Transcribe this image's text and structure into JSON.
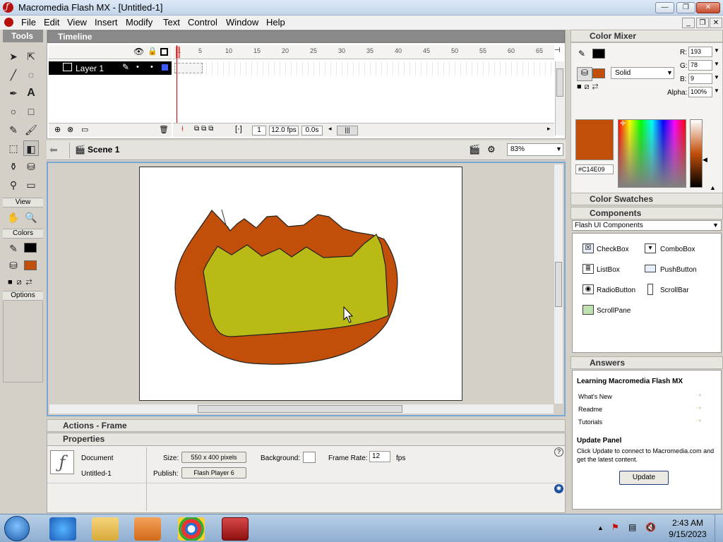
{
  "window": {
    "title": "Macromedia Flash MX - [Untitled-1]"
  },
  "menu": [
    "File",
    "Edit",
    "View",
    "Insert",
    "Modify",
    "Text",
    "Control",
    "Window",
    "Help"
  ],
  "tools": {
    "title": "Tools",
    "view_label": "View",
    "colors_label": "Colors",
    "options_label": "Options"
  },
  "timeline": {
    "title": "Timeline",
    "layer_name": "Layer 1",
    "frame_ticks": [
      "1",
      "5",
      "10",
      "15",
      "20",
      "25",
      "30",
      "35",
      "40",
      "45",
      "50",
      "55",
      "60",
      "65"
    ],
    "current_frame": "1",
    "fps": "12.0 fps",
    "time": "0.0s"
  },
  "stage": {
    "scene": "Scene 1",
    "zoom": "83%"
  },
  "panels": {
    "actions": "Actions - Frame",
    "properties": "Properties"
  },
  "properties": {
    "type": "Document",
    "name": "Untitled-1",
    "size_label": "Size:",
    "size_value": "550 x 400 pixels",
    "background_label": "Background:",
    "framerate_label": "Frame Rate:",
    "framerate_value": "12",
    "fps_unit": "fps",
    "publish_label": "Publish:",
    "publish_value": "Flash Player 6"
  },
  "color_mixer": {
    "title": "Color Mixer",
    "r_label": "R:",
    "r": "193",
    "g_label": "G:",
    "g": "78",
    "b_label": "B:",
    "b": "9",
    "alpha_label": "Alpha:",
    "alpha": "100%",
    "fill_type": "Solid",
    "hex": "#C14E09",
    "stroke_color": "#000000",
    "fill_color": "#C14E09"
  },
  "color_swatches": {
    "title": "Color Swatches"
  },
  "components": {
    "title": "Components",
    "set": "Flash UI Components",
    "items": [
      "CheckBox",
      "ComboBox",
      "ListBox",
      "PushButton",
      "RadioButton",
      "ScrollBar",
      "ScrollPane"
    ]
  },
  "answers": {
    "title": "Answers",
    "heading": "Learning Macromedia Flash MX",
    "links": [
      "What's New",
      "Readme",
      "Tutorials"
    ],
    "update_title": "Update Panel",
    "update_text": "Click Update to connect to Macromedia.com and get the latest content.",
    "update_button": "Update"
  },
  "taskbar": {
    "time": "2:43 AM",
    "date": "9/15/2023"
  },
  "colors": {
    "shape_outer": "#C14E09",
    "shape_inner": "#B9BA16",
    "selection_blue": "#78A7D4"
  }
}
